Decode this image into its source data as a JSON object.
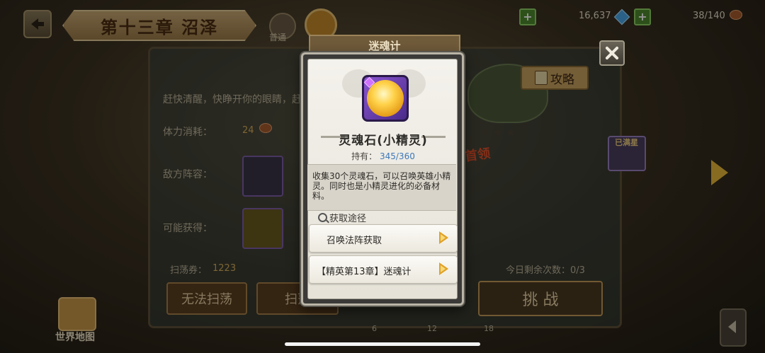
{
  "hud": {
    "chapter_title": "第十三章 沼泽",
    "mode_normal_label": "普通",
    "gems": "16,637",
    "stamina": "38/140",
    "plus_symbol": "+"
  },
  "stage": {
    "description": "赶快清醒，快睁开你的眼睛，赶",
    "stamina_cost_label": "体力消耗：",
    "stamina_cost_value": "24",
    "enemy_label": "敌方阵容：",
    "reward_label": "可能获得：",
    "sweep_ticket_label": "扫荡券：",
    "sweep_ticket_value": "1223",
    "remaining_label": "今日剩余次数：0/3",
    "btn_cannot_sweep": "无法扫荡",
    "btn_sweep": "扫荡",
    "btn_challenge": "挑 战",
    "strategy_label": "攻略",
    "first_clear": "首领",
    "full_star": "已满星",
    "node_numbers": [
      "6",
      "12",
      "18"
    ]
  },
  "world_map_label": "世界地图",
  "popup": {
    "ribbon_title": "迷魂计",
    "item_name": "灵魂石(小精灵)",
    "hold_label": "持有：",
    "hold_value": "345/360",
    "description": "收集30个灵魂石，可以召唤英雄小精灵。同时也是小精灵进化的必备材料。",
    "source_title": "获取途径",
    "sources": [
      {
        "label": "召唤法阵获取"
      },
      {
        "label": "【精英第13章】迷魂计"
      }
    ]
  }
}
